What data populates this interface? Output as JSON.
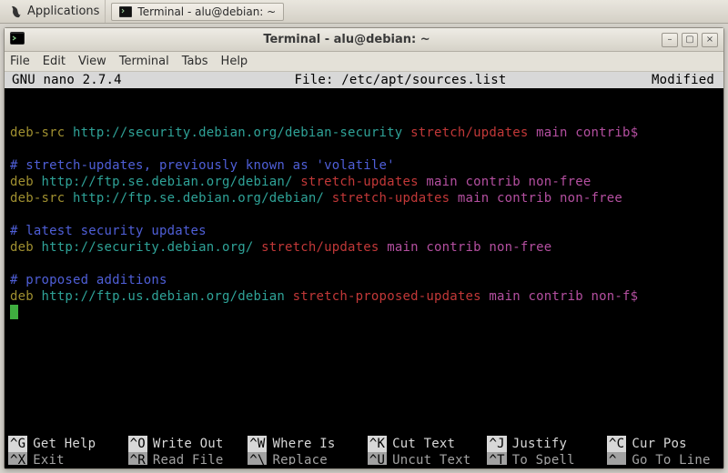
{
  "taskbar": {
    "applications_label": "Applications",
    "task_label": "Terminal - alu@debian: ~"
  },
  "window": {
    "title": "Terminal - alu@debian: ~",
    "min_glyph": "–",
    "max_glyph": "▢",
    "close_glyph": "×"
  },
  "menubar": {
    "file": "File",
    "edit": "Edit",
    "view": "View",
    "terminal": "Terminal",
    "tabs": "Tabs",
    "help": "Help"
  },
  "nano": {
    "app": "GNU nano 2.7.4",
    "file_label": "File: /etc/apt/sources.list",
    "status": "Modified"
  },
  "lines": {
    "blank": "",
    "l1a": "deb-src",
    "l1b": " http://security.debian.org/debian-security",
    "l1c": " stretch/updates",
    "l1d": " main contrib$",
    "c1": "# stretch-updates, previously known as 'volatile'",
    "l2a": "deb",
    "l2b": " http://ftp.se.debian.org/debian/",
    "l2c": " stretch-updates",
    "l2d": " main contrib non-free",
    "l3a": "deb-src",
    "l3b": " http://ftp.se.debian.org/debian/",
    "l3c": " stretch-updates",
    "l3d": " main contrib non-free",
    "c2": "# latest security updates",
    "l4a": "deb",
    "l4b": " http://security.debian.org/",
    "l4c": " stretch/updates",
    "l4d": " main contrib non-free",
    "c3": "# proposed additions",
    "l5a": "deb",
    "l5b": " http://ftp.us.debian.org/debian",
    "l5c": " stretch-proposed-updates",
    "l5d": " main contrib non-f$"
  },
  "footer": {
    "r1": {
      "k1": "^G",
      "t1": "Get Help",
      "k2": "^O",
      "t2": "Write Out",
      "k3": "^W",
      "t3": "Where Is",
      "k4": "^K",
      "t4": "Cut Text",
      "k5": "^J",
      "t5": "Justify",
      "k6": "^C",
      "t6": "Cur Pos"
    },
    "r2": {
      "k1": "^X",
      "t1": "Exit",
      "k2": "^R",
      "t2": "Read File",
      "k3": "^\\",
      "t3": "Replace",
      "k4": "^U",
      "t4": "Uncut Text",
      "k5": "^T",
      "t5": "To Spell",
      "k6": "^_",
      "t6": "Go To Line"
    }
  }
}
